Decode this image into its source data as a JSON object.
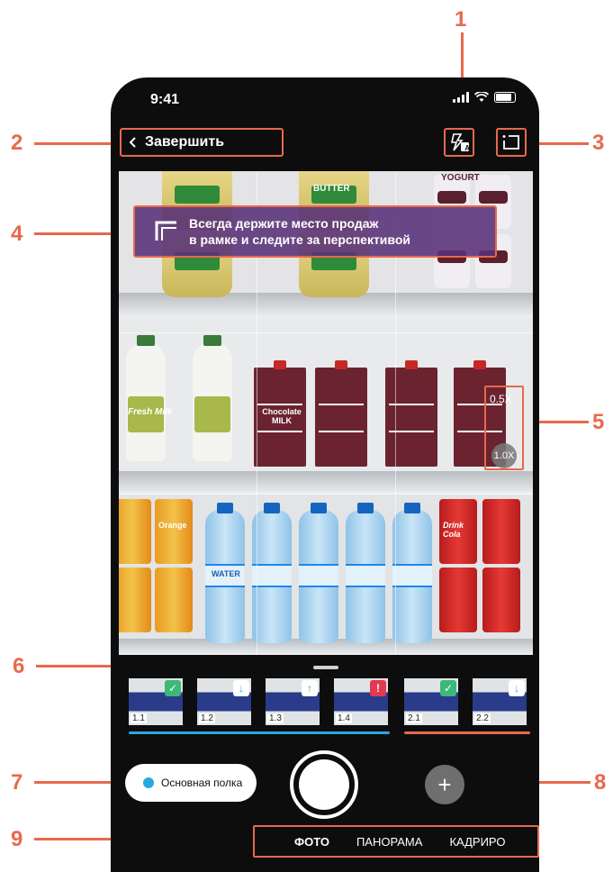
{
  "status": {
    "time": "9:41"
  },
  "topbar": {
    "back_label": "Завершить",
    "flash_mode": "A"
  },
  "hint": {
    "line1": "Всегда держите место продаж",
    "line2": "в рамке и следите за перспективой"
  },
  "zoom": {
    "level_a": "0.5X",
    "level_b": "1.0X"
  },
  "products": {
    "butter": "BUTTER",
    "yogurt": "YOGURT",
    "milk": "Fresh Milk",
    "chocolate_milk": "Chocolate MILK",
    "orange": "Orange",
    "water": "WATER",
    "cola": "Drink Cola"
  },
  "thumbnails": [
    {
      "label": "1.1",
      "status": "ok"
    },
    {
      "label": "1.2",
      "status": "download"
    },
    {
      "label": "1.3",
      "status": "upload"
    },
    {
      "label": "1.4",
      "status": "error"
    },
    {
      "label": "2.1",
      "status": "ok"
    },
    {
      "label": "2.2",
      "status": "download"
    }
  ],
  "shelf_selector": {
    "label": "Основная полка"
  },
  "add_button": {
    "label": "+"
  },
  "modes": {
    "photo": "ФОТО",
    "panorama": "ПАНОРАМА",
    "crop": "КАДРИРО"
  },
  "callouts": [
    "1",
    "2",
    "3",
    "4",
    "5",
    "6",
    "7",
    "8",
    "9"
  ],
  "colors": {
    "accent": "#e8694a",
    "blue": "#29a8e0",
    "ok": "#3cb878",
    "error": "#e53950"
  }
}
